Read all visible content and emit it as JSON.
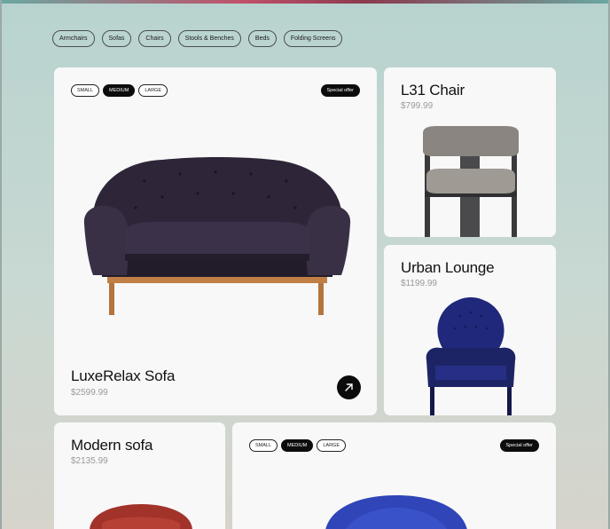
{
  "categories": [
    "Armchairs",
    "Sofas",
    "Chairs",
    "Stools & Benches",
    "Beds",
    "Folding Screens"
  ],
  "size_options": [
    "SMALL",
    "MEDIUM",
    "LARGE"
  ],
  "selected_size": "MEDIUM",
  "offer_label": "Special offer",
  "products": {
    "luxe": {
      "name": "LuxeRelax Sofa",
      "price": "$2599.99"
    },
    "l31": {
      "name": "L31 Chair",
      "price": "$799.99"
    },
    "urban": {
      "name": "Urban Lounge",
      "price": "$1199.99"
    },
    "modern": {
      "name": "Modern sofa",
      "price": "$2135.99"
    }
  },
  "colors": {
    "sofa_velvet": "#2e2638",
    "urban_velvet": "#1d2466",
    "modern_red": "#a2332a",
    "blue_chair": "#2f45b8",
    "accent_dark": "#0b0b0b"
  },
  "icons": {
    "open_product": "arrow-up-right-icon"
  }
}
